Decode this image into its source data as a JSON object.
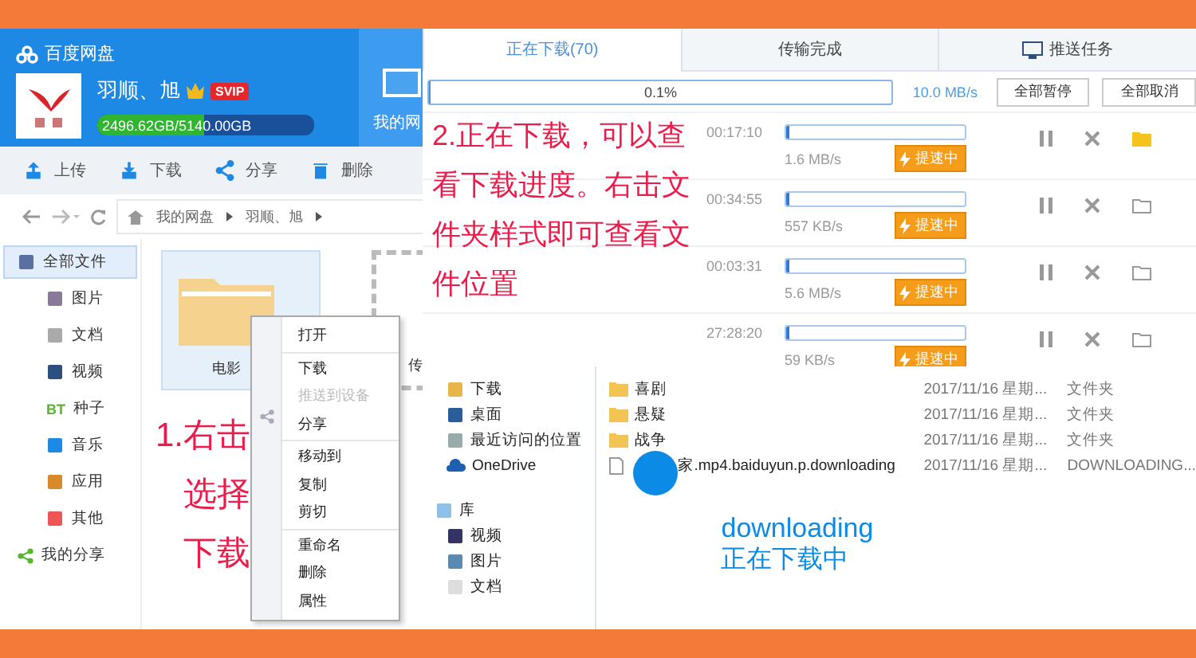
{
  "netdisk": {
    "app_name": "百度网盘",
    "user": "羽顺、旭",
    "badge": "SVIP",
    "storage_used": "2496.62GB",
    "storage_total": "/5140.00GB",
    "level": 0.49,
    "side_button": "我的网",
    "toolbar": [
      "上传",
      "下载",
      "分享",
      "删除"
    ],
    "breadcrumb": [
      "我的网盘",
      "羽顺、旭"
    ],
    "sidebar": [
      {
        "label": "全部文件",
        "selected": true,
        "children": [
          {
            "label": "图片",
            "selected": false
          },
          {
            "label": "文档",
            "selected": false
          },
          {
            "label": "视频",
            "selected": false
          },
          {
            "label": "种子",
            "selected": false
          },
          {
            "label": "音乐",
            "selected": false
          },
          {
            "label": "应用",
            "selected": false
          },
          {
            "label": "其他",
            "selected": false
          }
        ]
      },
      {
        "label": "我的分享",
        "selected": false
      }
    ],
    "bt_mark": "BT",
    "tiles": [
      {
        "name": "电影",
        "kind": "folder"
      },
      {
        "name": "传",
        "kind": "upload"
      }
    ],
    "context_menu": [
      [
        {
          "label": "打开",
          "disabled": false
        }
      ],
      [
        {
          "label": "下载",
          "disabled": false
        },
        {
          "label": "推送到设备",
          "disabled": true
        },
        {
          "label": "分享",
          "disabled": false
        }
      ],
      [
        {
          "label": "移动到",
          "disabled": false
        },
        {
          "label": "复制",
          "disabled": false
        },
        {
          "label": "剪切",
          "disabled": false
        }
      ],
      [
        {
          "label": "重命名",
          "disabled": false
        },
        {
          "label": "删除",
          "disabled": false
        },
        {
          "label": "属性",
          "disabled": false
        }
      ]
    ],
    "annotation": [
      "1.右击",
      "选择",
      "下载"
    ]
  },
  "downloads": {
    "tabs": [
      {
        "label": "正在下载(70)",
        "selected": true
      },
      {
        "label": "传输完成",
        "selected": false
      },
      {
        "label": "推送任务",
        "selected": false
      }
    ],
    "total": {
      "progress": "0.1%",
      "level": 0.001,
      "speed": "10.0 MB/s",
      "buttons": [
        "全部暂停",
        "全部取消"
      ]
    },
    "rows": [
      {
        "time": "00:17:10",
        "speed": "1.6 MB/s",
        "level": 0.01,
        "boost": "提速中",
        "hover": true
      },
      {
        "time": "00:34:55",
        "speed": "557 KB/s",
        "level": 0.005,
        "boost": "提速中",
        "hover": false
      },
      {
        "time": "00:03:31",
        "speed": "5.6 MB/s",
        "level": 0.02,
        "boost": "提速中",
        "hover": false
      },
      {
        "time": "27:28:20",
        "speed": "59 KB/s",
        "level": 0.003,
        "boost": "提速中",
        "hover": false
      }
    ],
    "annotation": "2.正在下载，可以查看下载进度。右击文件夹样式即可查看文件位置"
  },
  "explorer": {
    "nav": [
      {
        "label": "下载"
      },
      {
        "label": "桌面"
      },
      {
        "label": "最近访问的位置"
      },
      {
        "label": "OneDrive"
      }
    ],
    "library": {
      "label": "库",
      "children": [
        {
          "label": "视频"
        },
        {
          "label": "图片"
        },
        {
          "label": "文档"
        }
      ]
    },
    "files": [
      {
        "name": "喜剧",
        "date": "2017/11/16 星期...",
        "type": "文件夹",
        "kind": "folder"
      },
      {
        "name": "悬疑",
        "date": "2017/11/16 星期...",
        "type": "文件夹",
        "kind": "folder"
      },
      {
        "name": "战争",
        "date": "2017/11/16 星期...",
        "type": "文件夹",
        "kind": "folder"
      },
      {
        "name": "家.mp4.baiduyun.p.downloading",
        "date": "2017/11/16 星期...",
        "type": "DOWNLOADING...",
        "kind": "file"
      }
    ],
    "annotation": [
      "downloading",
      "正在下载中"
    ]
  }
}
